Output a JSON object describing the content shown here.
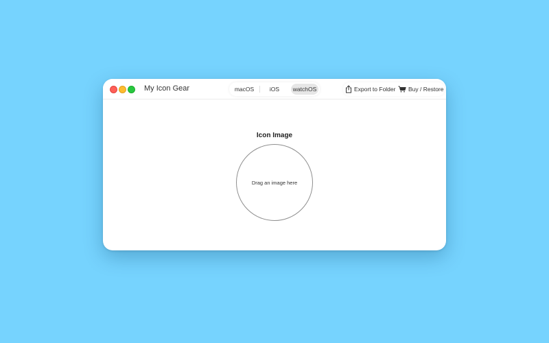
{
  "window": {
    "title": "My Icon Gear"
  },
  "platform_tabs": [
    {
      "label": "macOS",
      "selected": false
    },
    {
      "label": "iOS",
      "selected": false
    },
    {
      "label": "watchOS",
      "selected": true
    }
  ],
  "toolbar": {
    "export_label": "Export to Folder",
    "export_icon": "share-icon",
    "buy_label": "Buy / Restore",
    "buy_icon": "cart-icon"
  },
  "main": {
    "section_title": "Icon Image",
    "drop_zone_text": "Drag an image here"
  },
  "colors": {
    "background": "#76d3fe",
    "window": "#ffffff",
    "close": "#ff5f57",
    "minimize": "#febc2e",
    "maximize": "#28c840",
    "selected_tab": "#e6e6e6"
  }
}
